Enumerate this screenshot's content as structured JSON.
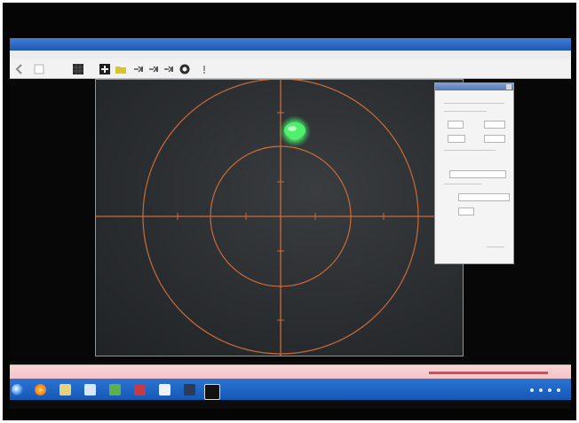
{
  "window": {
    "title": "",
    "menu_items": [
      "",
      "",
      "",
      ""
    ]
  },
  "toolbar": {
    "icons": [
      "arrow-left-icon",
      "blank-icon",
      "grid-icon",
      "add-icon",
      "folder-icon",
      "step-1-icon",
      "step-2-icon",
      "step-3-icon",
      "target-icon",
      "help-icon"
    ]
  },
  "colors": {
    "screen_bg": "#0c0c0c",
    "camera_bg": "#2b2e31",
    "reticle": "#cc6b38",
    "frame_border": "#7ea86a",
    "spot": "#59f57a",
    "panel_bg": "#f4f4f4",
    "taskbar": "#1f65c5"
  },
  "side_panel": {
    "title": "",
    "labels": [
      "",
      "",
      "",
      "",
      "",
      ""
    ]
  },
  "taskbar": {
    "icons": [
      "start-button-icon",
      "browser-icon",
      "folder-icon",
      "app-icon",
      "media-icon",
      "document-icon",
      "settings-icon",
      "screen-icon"
    ]
  }
}
